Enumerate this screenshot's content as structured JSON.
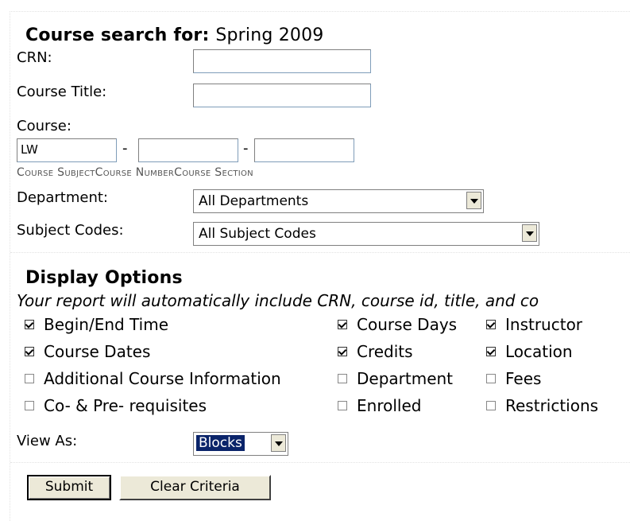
{
  "header": {
    "prefix": "Course search for:",
    "term": "Spring 2009"
  },
  "fields": {
    "crn_label": "CRN:",
    "crn_value": "",
    "title_label": "Course Title:",
    "title_value": "",
    "course_label": "Course:",
    "course_subject_value": "LW",
    "course_number_value": "",
    "course_section_value": "",
    "dash": "-",
    "sub_subject": "Course Subject",
    "sub_number": "Course Number",
    "sub_section": "Course Section",
    "department_label": "Department:",
    "department_value": "All Departments",
    "subject_codes_label": "Subject Codes:",
    "subject_codes_value": "All Subject Codes"
  },
  "display": {
    "heading": "Display Options",
    "note": "Your report will automatically include CRN, course id, title, and co",
    "options": [
      {
        "label": "Begin/End Time",
        "checked": true
      },
      {
        "label": "Course Days",
        "checked": true
      },
      {
        "label": "Instructor",
        "checked": true
      },
      {
        "label": "Course Dates",
        "checked": true
      },
      {
        "label": "Credits",
        "checked": true
      },
      {
        "label": "Location",
        "checked": true
      },
      {
        "label": "Additional Course Information",
        "checked": false
      },
      {
        "label": "Department",
        "checked": false
      },
      {
        "label": "Fees",
        "checked": false
      },
      {
        "label": "Co- & Pre- requisites",
        "checked": false
      },
      {
        "label": "Enrolled",
        "checked": false
      },
      {
        "label": "Restrictions",
        "checked": false
      }
    ],
    "view_as_label": "View As:",
    "view_as_value": "Blocks"
  },
  "buttons": {
    "submit": "Submit",
    "clear": "Clear Criteria"
  },
  "colors": {
    "select_highlight": "#0a246a",
    "button_face": "#ece9d8"
  }
}
